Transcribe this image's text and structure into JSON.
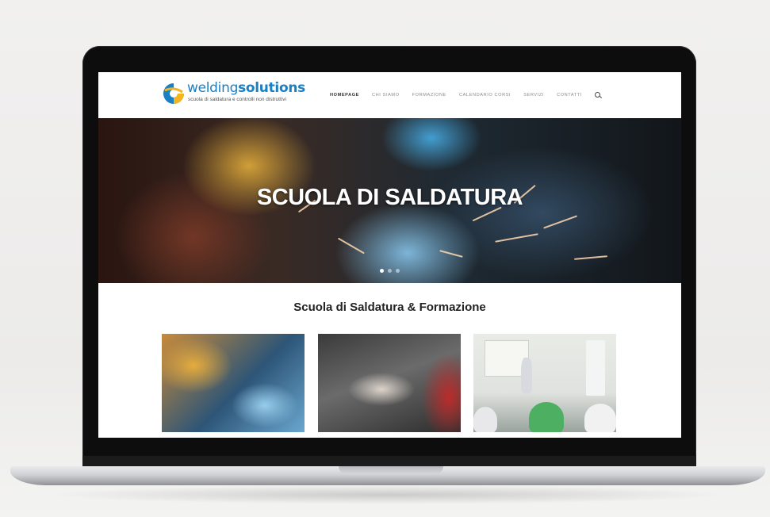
{
  "site": {
    "logo": {
      "word_light": "welding",
      "word_bold": "solutions",
      "tagline": "scuola di saldatura e controlli non distruttivi",
      "colors": {
        "blue": "#1a7fc3",
        "yellow": "#f2b51c"
      }
    },
    "nav": {
      "items": [
        {
          "label": "HOMEPAGE",
          "active": true
        },
        {
          "label": "CHI SIAMO",
          "active": false
        },
        {
          "label": "FORMAZIONE",
          "active": false
        },
        {
          "label": "CALENDARIO CORSI",
          "active": false
        },
        {
          "label": "SERVIZI",
          "active": false
        },
        {
          "label": "CONTATTI",
          "active": false
        }
      ],
      "search_icon": "search-icon"
    },
    "hero": {
      "title": "SCUOLA DI SALDATURA",
      "slides": 3,
      "active_slide": 1
    },
    "section": {
      "title": "Scuola di Saldatura & Formazione"
    }
  }
}
